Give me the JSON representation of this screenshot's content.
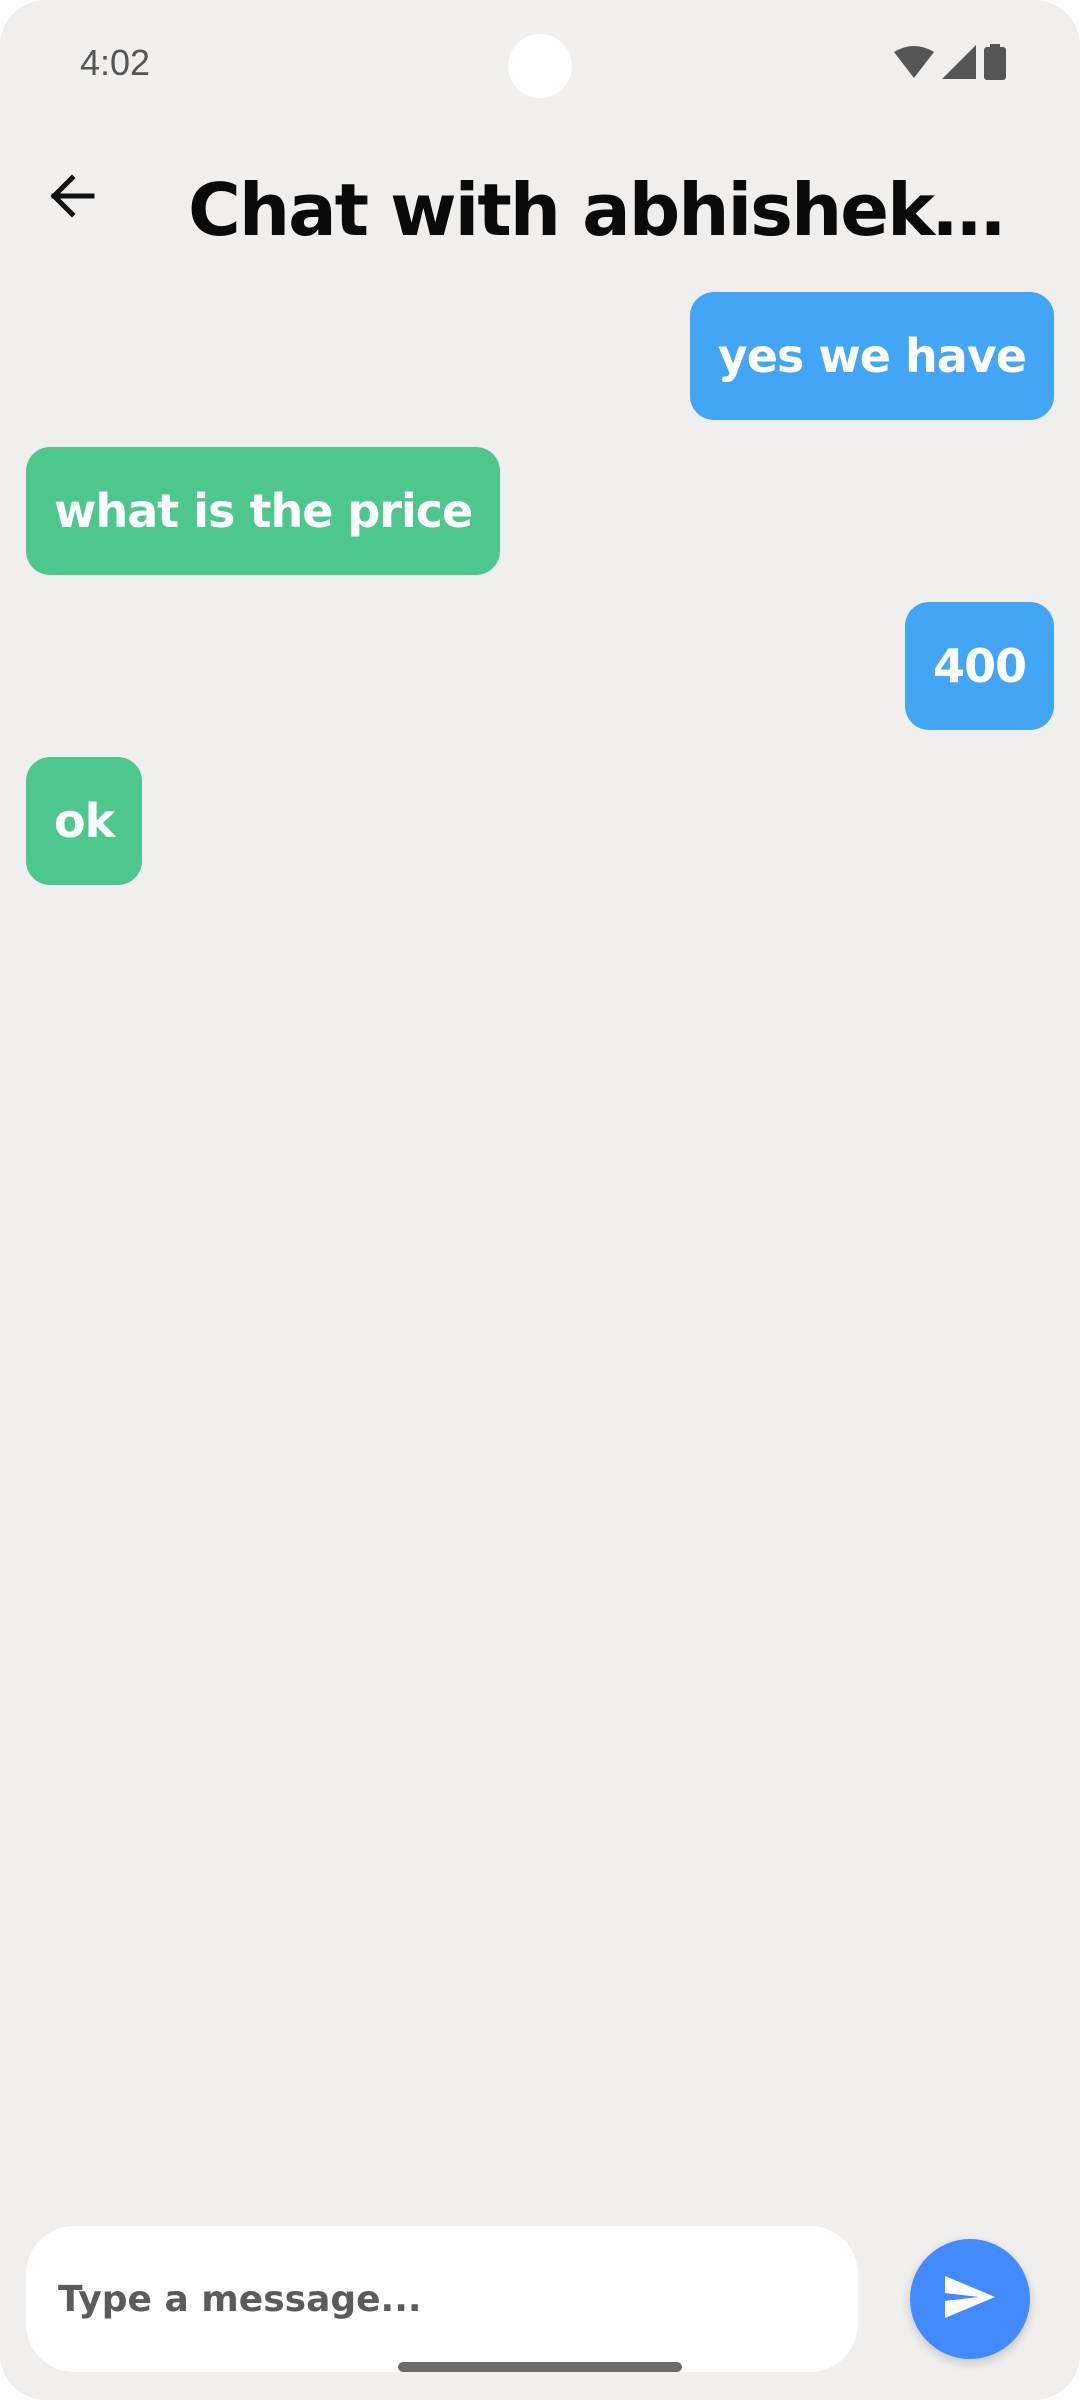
{
  "status_bar": {
    "time": "4:02",
    "icons": [
      "wifi-icon",
      "cell-signal-icon",
      "battery-icon"
    ]
  },
  "header": {
    "back_icon": "arrow-left-icon",
    "title": "Chat with abhisheksh..."
  },
  "colors": {
    "background": "#f0efee",
    "sent_bubble": "#42a5f5",
    "received_bubble": "#4ec78f",
    "send_button": "#448aff"
  },
  "messages": [
    {
      "text": "yes we have",
      "direction": "sent"
    },
    {
      "text": "what is the price",
      "direction": "received"
    },
    {
      "text": "400",
      "direction": "sent"
    },
    {
      "text": "ok",
      "direction": "received"
    }
  ],
  "composer": {
    "placeholder": "Type a message...",
    "value": "",
    "send_icon": "send-icon"
  }
}
